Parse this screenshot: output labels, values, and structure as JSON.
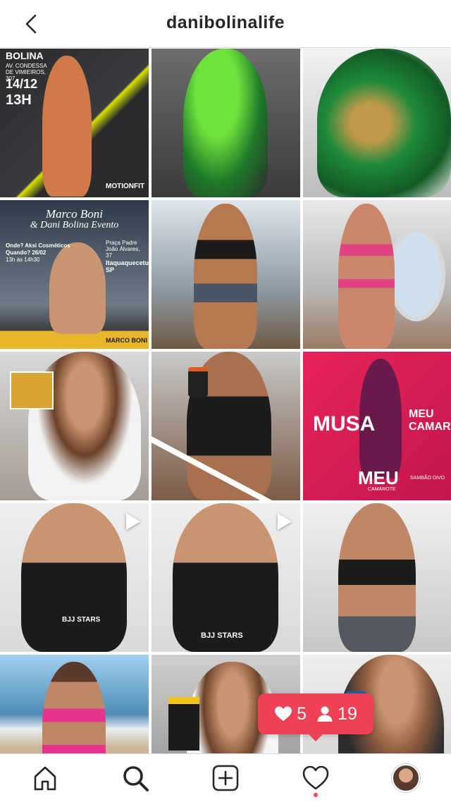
{
  "header": {
    "title": "danibolinalife"
  },
  "tiles": [
    {
      "bg": "linear-gradient(135deg,#2b2b2e 0%,#3a3a3e 55%,#d8e000 56%,#2b2b2e 62%)",
      "caption_lines": [
        "BOLINA",
        "AV. CONDESSA DE VIMIEIROS, 307",
        "14/12",
        "13H",
        "MOTIONFIT"
      ],
      "person": "#d07a4a"
    },
    {
      "bg": "linear-gradient(180deg,#6d6d6d 0%,#3b3b3b 100%)",
      "person": "#3fb53f"
    },
    {
      "bg": "linear-gradient(180deg,#f2f2f2 0%,#bcbcbc 100%)",
      "person": "#1e8a3a"
    },
    {
      "bg": "linear-gradient(180deg,#2f3a49 0%,#6f7b88 70%,#e8b62a 88%)",
      "caption_lines": [
        "Marco Boni",
        "& Dani Bolina Evento",
        "Onde? Aksi Cosméticos",
        "Quando? 26/02",
        "13h às 14h30",
        "Praça Padre João Álvares, 37",
        "Itaquaquecetuba SP",
        "MARCO BONI"
      ],
      "person": "#c99470"
    },
    {
      "bg": "linear-gradient(180deg,#dfe6ec 0%,#8e9aa4 60%,#6e5a44 100%)",
      "person": "#b5784f"
    },
    {
      "bg": "linear-gradient(180deg,#e9e9e9 0%,#b7b7b7 60%,#9b7a62 100%)",
      "person": "#c9866a"
    },
    {
      "bg": "linear-gradient(180deg,#d8d8d8 0%,#a59b94 100%)",
      "person": "#b07452"
    },
    {
      "bg": "linear-gradient(180deg,#c9c9c9 0%,#7a5b46 100%)",
      "person": "#a8704f"
    },
    {
      "bg": "linear-gradient(135deg,#e8225a 0%,#c2184e 100%)",
      "caption_lines": [
        "MUSA",
        "MEU CAMAROTE",
        "MEU",
        "CAMAROTE",
        "SAMBÃO",
        "DIVO"
      ],
      "person": "#6a1a4a"
    },
    {
      "bg": "linear-gradient(180deg,#efefef 0%,#d9d9d9 100%)",
      "caption_lines": [
        "BJJ STARS"
      ],
      "video": true,
      "person": "#1c1c1c"
    },
    {
      "bg": "linear-gradient(180deg,#efefef 0%,#d9d9d9 100%)",
      "caption_lines": [
        "BJJ STARS"
      ],
      "video": true,
      "person": "#1c1c1c"
    },
    {
      "bg": "linear-gradient(180deg,#f0f0f0 0%,#c7c7c7 100%)",
      "person": "#c08766"
    },
    {
      "bg": "linear-gradient(180deg,#9fd0ee 0%,#4e8db5 45%,#cdb79a 60%,#b59b7c 100%)",
      "person": "#e8338c"
    },
    {
      "bg": "linear-gradient(180deg,#cfcfcf 0%,#8c8c8c 100%)",
      "person": "#8a5a3e"
    },
    {
      "bg": "linear-gradient(180deg,#eeeeee 0%,#cfcfcf 100%)",
      "person": "#2d2d2d"
    }
  ],
  "activity": {
    "likes": "5",
    "follows": "19",
    "color": "#ee4156"
  },
  "tabbar": {
    "items": [
      "home-icon",
      "search-icon",
      "new-post-icon",
      "activity-heart-icon",
      "profile-avatar"
    ],
    "notification_color": "#ed4956"
  }
}
